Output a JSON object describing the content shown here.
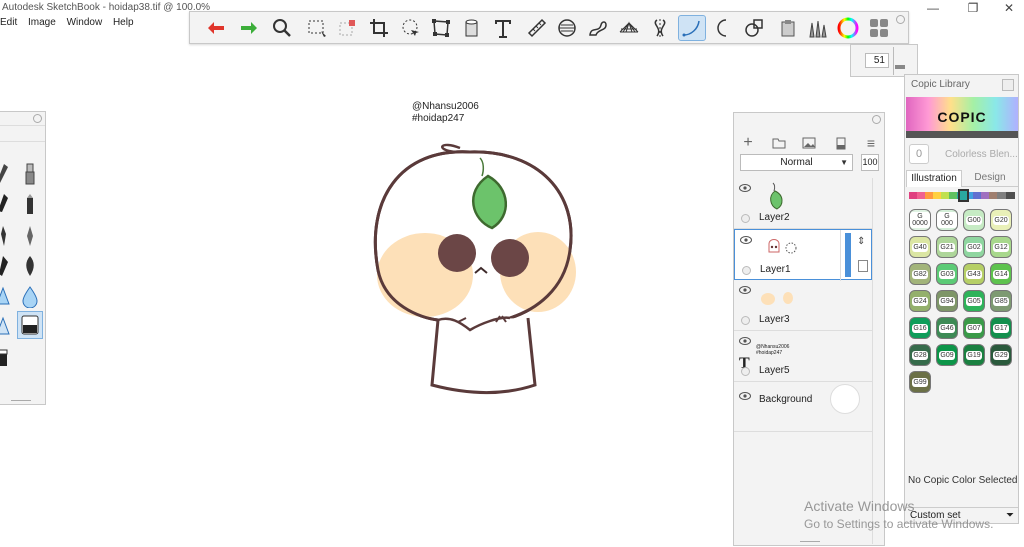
{
  "app": {
    "title": "Autodesk SketchBook - hoidap38.tif @ 100.0%",
    "menu": [
      "Edit",
      "Image",
      "Window",
      "Help"
    ],
    "window_controls": [
      "—",
      "❐",
      "✕"
    ]
  },
  "toolbar": {
    "tools": [
      "undo-icon",
      "redo-icon",
      "zoom-icon",
      "rect-select-icon",
      "transform-icon",
      "crop-icon",
      "lasso-icon",
      "distort-icon",
      "fill-icon",
      "text-icon",
      "ruler-icon",
      "ellipse-guide-icon",
      "french-curve-icon",
      "perspective-icon",
      "symmetry-icon",
      "stroke-icon",
      "ellipse-icon",
      "shape-icon",
      "copic-icon",
      "brush-library-icon",
      "color-wheel-icon",
      "layers-icon"
    ],
    "active_tool": "stroke-icon"
  },
  "brush_size": "51",
  "canvas": {
    "caption_line1": "@Nhansu2006",
    "caption_line2": "#hoidap247"
  },
  "layers": {
    "blend_mode": "Normal",
    "opacity": "100",
    "items": [
      {
        "name": "Layer2"
      },
      {
        "name": "Layer1",
        "selected": true
      },
      {
        "name": "Layer3"
      },
      {
        "name": "Layer5",
        "thumb_line1": "@Nhansu2006",
        "thumb_line2": "#hoidap247"
      },
      {
        "name": "Background"
      }
    ]
  },
  "copic": {
    "header": "Copic Library",
    "logo": "COPIC",
    "colorless_value": "0",
    "colorless_label": "Colorless Blen...",
    "tabs": [
      "Illustration",
      "Design"
    ],
    "swatches": [
      {
        "code": "G 0000",
        "color": "#dff2e2"
      },
      {
        "code": "G 000",
        "color": "#d4efd8"
      },
      {
        "code": "G00",
        "color": "#c6ebc4"
      },
      {
        "code": "G20",
        "color": "#e9f0b8"
      },
      {
        "code": "G40",
        "color": "#dbe6a3"
      },
      {
        "code": "G21",
        "color": "#aed69a"
      },
      {
        "code": "G02",
        "color": "#8fd6a0"
      },
      {
        "code": "G12",
        "color": "#a8d88c"
      },
      {
        "code": "G82",
        "color": "#a2b47a"
      },
      {
        "code": "G03",
        "color": "#5ccb76"
      },
      {
        "code": "G43",
        "color": "#b6cf66"
      },
      {
        "code": "G14",
        "color": "#5ec34e"
      },
      {
        "code": "G24",
        "color": "#94b06c"
      },
      {
        "code": "G94",
        "color": "#7e9668"
      },
      {
        "code": "G05",
        "color": "#2eb35a"
      },
      {
        "code": "G85",
        "color": "#7e9a72"
      },
      {
        "code": "G16",
        "color": "#0f9d5a"
      },
      {
        "code": "G46",
        "color": "#3d8a55"
      },
      {
        "code": "G07",
        "color": "#3a9a48"
      },
      {
        "code": "G17",
        "color": "#138f4d"
      },
      {
        "code": "G28",
        "color": "#356b4a"
      },
      {
        "code": "G09",
        "color": "#0c9548"
      },
      {
        "code": "G19",
        "color": "#1a8040"
      },
      {
        "code": "G29",
        "color": "#2a5a3c"
      },
      {
        "code": "G99",
        "color": "#6b7046"
      }
    ],
    "no_selection": "No Copic Color Selected",
    "custom_set": "Custom set"
  },
  "watermark": {
    "line1": "Activate Windows",
    "line2": "Go to Settings to activate Windows."
  }
}
